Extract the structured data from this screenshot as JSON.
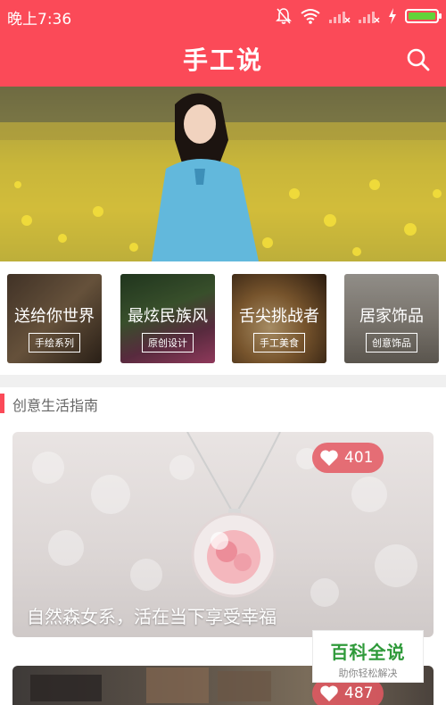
{
  "status_bar": {
    "time": "晚上7:36",
    "battery_level": 1.0,
    "battery_color": "#62d33a"
  },
  "header": {
    "title": "手工说",
    "background": "#fb4a58",
    "search_icon": "search-icon"
  },
  "banner": {
    "slide_count": 3,
    "active_slide": 2
  },
  "categories": [
    {
      "title": "送给你世界",
      "tag": "手绘系列"
    },
    {
      "title": "最炫民族风",
      "tag": "原创设计"
    },
    {
      "title": "舌尖挑战者",
      "tag": "手工美食"
    },
    {
      "title": "居家饰品",
      "tag": "创意饰品"
    }
  ],
  "section": {
    "title": "创意生活指南",
    "accent": "#fb4a58"
  },
  "feed": [
    {
      "likes": "401",
      "caption": "自然森女系，活在当下享受幸福"
    },
    {
      "likes": "487",
      "caption": ""
    }
  ],
  "watermark": {
    "main": "百科全说",
    "sub": "助你轻松解决"
  }
}
